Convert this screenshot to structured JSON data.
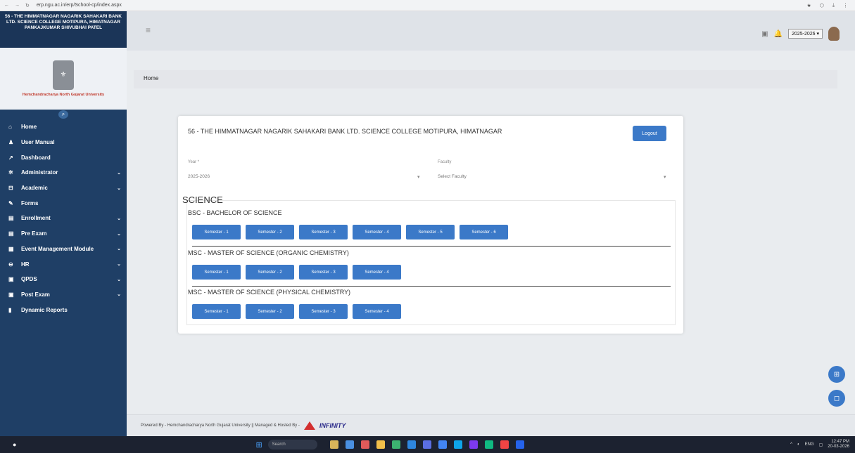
{
  "browser": {
    "url": "erp.ngu.ac.in/erp/School-cp/index.aspx"
  },
  "sidebar": {
    "college_name": "56 - THE HIMMATNAGAR NAGARIK SAHAKARI BANK LTD. SCIENCE COLLEGE MOTIPURA, HIMATNAGAR PANKAJKUMAR SHIVUBHAI PATEL",
    "university": "Hemchandracharya North Gujarat University",
    "items": [
      {
        "label": "Home",
        "icon": "home-icon",
        "has_chevron": false
      },
      {
        "label": "User Manual",
        "icon": "user-icon",
        "has_chevron": false
      },
      {
        "label": "Dashboard",
        "icon": "chart-icon",
        "has_chevron": false
      },
      {
        "label": "Administrator",
        "icon": "gear-icon",
        "has_chevron": true
      },
      {
        "label": "Academic",
        "icon": "bank-icon",
        "has_chevron": true
      },
      {
        "label": "Forms",
        "icon": "edit-icon",
        "has_chevron": false
      },
      {
        "label": "Enrollment",
        "icon": "card-icon",
        "has_chevron": true
      },
      {
        "label": "Pre Exam",
        "icon": "card-icon",
        "has_chevron": true
      },
      {
        "label": "Event Management Module",
        "icon": "calendar-icon",
        "has_chevron": true
      },
      {
        "label": "HR",
        "icon": "hr-icon",
        "has_chevron": true
      },
      {
        "label": "QPDS",
        "icon": "qpds-icon",
        "has_chevron": true
      },
      {
        "label": "Post Exam",
        "icon": "post-exam-icon",
        "has_chevron": true
      },
      {
        "label": "Dynamic Reports",
        "icon": "report-icon",
        "has_chevron": false
      }
    ]
  },
  "topbar": {
    "year_select": "2025-2026 ▾"
  },
  "breadcrumb": "Home",
  "card": {
    "title": "56 - THE HIMMATNAGAR NAGARIK SAHAKARI BANK LTD. SCIENCE COLLEGE MOTIPURA, HIMATNAGAR",
    "logout": "Logout",
    "year_label": "Year *",
    "year_value": "2025-2026",
    "faculty_label": "Faculty",
    "faculty_placeholder": "Select Faculty",
    "group": "SCIENCE",
    "programs": [
      {
        "name": "BSC - BACHELOR OF SCIENCE",
        "semesters": [
          "Semester - 1",
          "Semester - 2",
          "Semester - 3",
          "Semester - 4",
          "Semester - 5",
          "Semester - 6"
        ]
      },
      {
        "name": "MSC - MASTER OF SCIENCE (ORGANIC CHEMISTRY)",
        "semesters": [
          "Semester - 1",
          "Semester - 2",
          "Semester - 3",
          "Semester - 4"
        ]
      },
      {
        "name": "MSC - MASTER OF SCIENCE (PHYSICAL CHEMISTRY)",
        "semesters": [
          "Semester - 1",
          "Semester - 2",
          "Semester - 3",
          "Semester - 4"
        ]
      }
    ]
  },
  "footer": {
    "text": "Powered By - Hemchandracharya North Gujarat University || Managed & Hosted By -",
    "brand": "INFINITY"
  },
  "taskbar": {
    "search": "Search",
    "lang": "ENG",
    "time": "12:47 PM",
    "date": "20-03-2026"
  }
}
